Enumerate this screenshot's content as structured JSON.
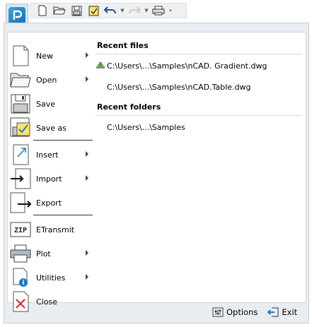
{
  "menu": {
    "items": [
      {
        "label": "New",
        "icon": "new-file-icon",
        "has_submenu": true
      },
      {
        "label": "Open",
        "icon": "open-folder-icon",
        "has_submenu": true
      },
      {
        "label": "Save",
        "icon": "save-disk-icon",
        "has_submenu": false
      },
      {
        "label": "Save as",
        "icon": "save-as-icon",
        "has_submenu": false
      },
      {
        "label": "Insert",
        "icon": "insert-icon",
        "has_submenu": true
      },
      {
        "label": "Import",
        "icon": "import-icon",
        "has_submenu": true
      },
      {
        "label": "Export",
        "icon": "export-icon",
        "has_submenu": false
      },
      {
        "label": "ETransmit",
        "icon": "zip-icon",
        "has_submenu": false
      },
      {
        "label": "Plot",
        "icon": "printer-icon",
        "has_submenu": true
      },
      {
        "label": "Utilities",
        "icon": "utilities-icon",
        "has_submenu": true
      },
      {
        "label": "Close",
        "icon": "close-doc-icon",
        "has_submenu": false
      }
    ]
  },
  "recent": {
    "files_heading": "Recent files",
    "files": [
      "C:\\Users\\...\\Samples\\nCAD. Gradient.dwg",
      "C:\\Users\\...\\Samples\\nCAD.Table.dwg"
    ],
    "folders_heading": "Recent folders",
    "folders": [
      "C:\\Users\\...\\Samples"
    ]
  },
  "footer": {
    "options_label": "Options",
    "exit_label": "Exit"
  },
  "colors": {
    "accent": "#1f78c8",
    "panel_bg": "#e9edf1",
    "close_red": "#e0202a"
  }
}
